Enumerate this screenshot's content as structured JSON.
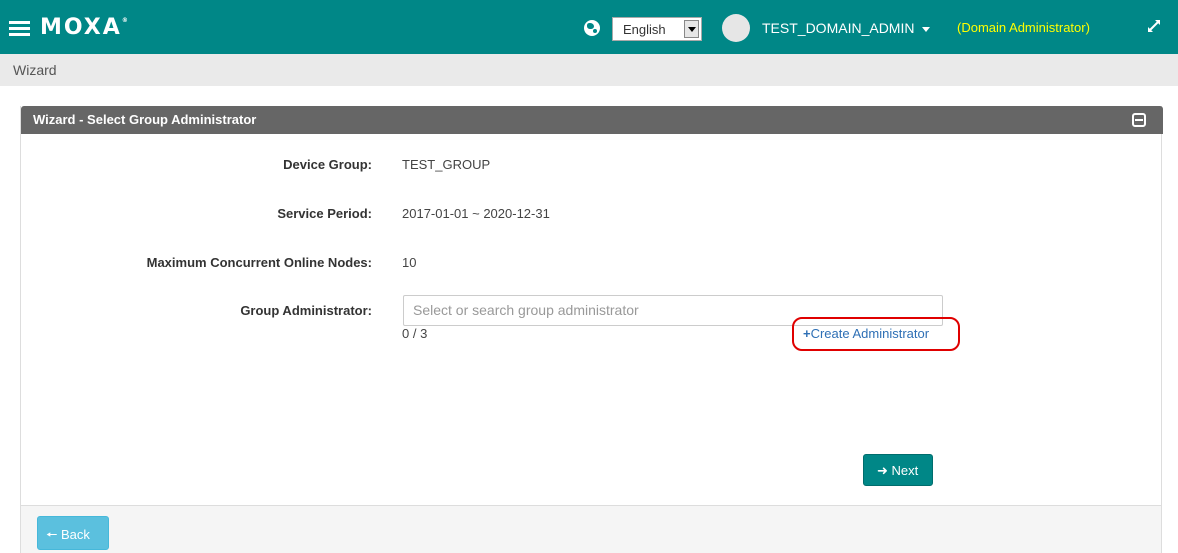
{
  "header": {
    "logo": "MOXA",
    "logo_mark": "®",
    "language": "English",
    "username": "TEST_DOMAIN_ADMIN",
    "role": "(Domain Administrator)",
    "icons": [
      "menu-icon",
      "globe-icon",
      "user-avatar",
      "expand-icon"
    ],
    "colors": {
      "bar": "#008787",
      "role_text": "#ffff00"
    }
  },
  "breadcrumb": {
    "label": "Wizard"
  },
  "panel": {
    "title": "Wizard - Select Group Administrator",
    "fields": {
      "device_group": {
        "label": "Device Group:",
        "value": "TEST_GROUP"
      },
      "service_period": {
        "label": "Service Period:",
        "value": "2017-01-01 ~ 2020-12-31"
      },
      "max_nodes": {
        "label": "Maximum Concurrent Online Nodes:",
        "value": "10"
      },
      "group_admin": {
        "label": "Group Administrator:",
        "placeholder": "Select or search group administrator",
        "counter": "0 / 3"
      }
    },
    "create_admin_label": "Create Administrator",
    "next_label": "Next",
    "back_label": "Back"
  }
}
